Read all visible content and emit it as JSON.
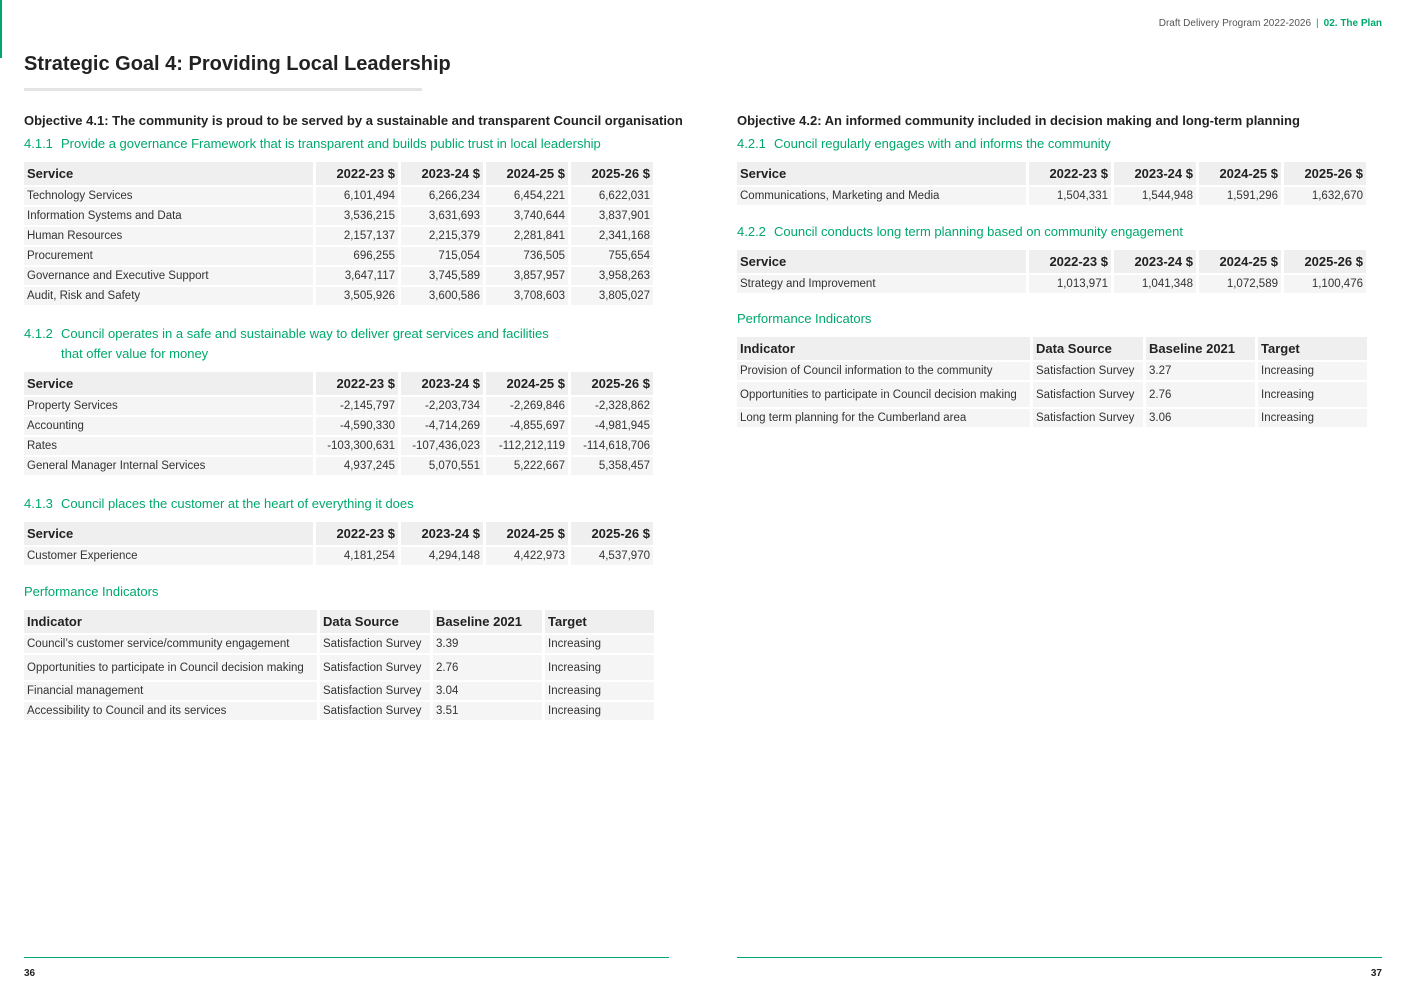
{
  "header": {
    "document_title": "Draft Delivery Program 2022-2026",
    "separator": "|",
    "section": "02. The Plan"
  },
  "left": {
    "goal_title": "Strategic Goal 4: Providing Local Leadership",
    "objective": "Objective 4.1: The community is proud to be served by a sustainable and transparent Council organisation",
    "sections": [
      {
        "number": "4.1.1",
        "title": "Provide a governance Framework that is transparent and builds public trust in local leadership",
        "columns": [
          "Service",
          "2022-23 $",
          "2023-24 $",
          "2024-25 $",
          "2025-26 $"
        ],
        "rows": [
          [
            "Technology Services",
            "6,101,494",
            "6,266,234",
            "6,454,221",
            "6,622,031"
          ],
          [
            "Information Systems and Data",
            "3,536,215",
            "3,631,693",
            "3,740,644",
            "3,837,901"
          ],
          [
            "Human Resources",
            "2,157,137",
            "2,215,379",
            "2,281,841",
            "2,341,168"
          ],
          [
            "Procurement",
            "696,255",
            "715,054",
            "736,505",
            "755,654"
          ],
          [
            "Governance and Executive Support",
            "3,647,117",
            "3,745,589",
            "3,857,957",
            "3,958,263"
          ],
          [
            "Audit, Risk and Safety",
            "3,505,926",
            "3,600,586",
            "3,708,603",
            "3,805,027"
          ]
        ]
      },
      {
        "number": "4.1.2",
        "title_line1": "Council operates in a safe and sustainable way to deliver great services and facilities",
        "title_line2": "that offer value for money",
        "columns": [
          "Service",
          "2022-23 $",
          "2023-24 $",
          "2024-25 $",
          "2025-26 $"
        ],
        "rows": [
          [
            "Property Services",
            "-2,145,797",
            "-2,203,734",
            "-2,269,846",
            "-2,328,862"
          ],
          [
            "Accounting",
            "-4,590,330",
            "-4,714,269",
            "-4,855,697",
            "-4,981,945"
          ],
          [
            "Rates",
            "-103,300,631",
            "-107,436,023",
            "-112,212,119",
            "-114,618,706"
          ],
          [
            "General Manager Internal Services",
            "4,937,245",
            "5,070,551",
            "5,222,667",
            "5,358,457"
          ]
        ]
      },
      {
        "number": "4.1.3",
        "title": "Council places the customer at the heart of everything it does",
        "columns": [
          "Service",
          "2022-23 $",
          "2023-24 $",
          "2024-25 $",
          "2025-26 $"
        ],
        "rows": [
          [
            "Customer Experience",
            "4,181,254",
            "4,294,148",
            "4,422,973",
            "4,537,970"
          ]
        ]
      }
    ],
    "performance": {
      "heading": "Performance Indicators",
      "columns": [
        "Indicator",
        "Data Source",
        "Baseline 2021",
        "Target"
      ],
      "rows": [
        [
          "Council’s customer service/community engagement",
          "Satisfaction Survey",
          "3.39",
          "Increasing"
        ],
        [
          "Opportunities to participate in Council decision making",
          "Satisfaction Survey",
          "2.76",
          "Increasing"
        ],
        [
          "Financial management",
          "Satisfaction Survey",
          "3.04",
          "Increasing"
        ],
        [
          "Accessibility to Council and its services",
          "Satisfaction Survey",
          "3.51",
          "Increasing"
        ]
      ]
    },
    "page_number": "36"
  },
  "right": {
    "objective": "Objective 4.2: An informed community included in decision making and long-term planning",
    "sections": [
      {
        "number": "4.2.1",
        "title": "Council regularly engages with and informs the community",
        "columns": [
          "Service",
          "2022-23 $",
          "2023-24 $",
          "2024-25 $",
          "2025-26 $"
        ],
        "rows": [
          [
            "Communications, Marketing and Media",
            "1,504,331",
            "1,544,948",
            "1,591,296",
            "1,632,670"
          ]
        ]
      },
      {
        "number": "4.2.2",
        "title": "Council conducts long term planning based on community engagement",
        "columns": [
          "Service",
          "2022-23 $",
          "2023-24 $",
          "2024-25 $",
          "2025-26 $"
        ],
        "rows": [
          [
            "Strategy and Improvement",
            "1,013,971",
            "1,041,348",
            "1,072,589",
            "1,100,476"
          ]
        ]
      }
    ],
    "performance": {
      "heading": "Performance Indicators",
      "columns": [
        "Indicator",
        "Data Source",
        "Baseline 2021",
        "Target"
      ],
      "rows": [
        [
          "Provision of Council information to the community",
          "Satisfaction Survey",
          "3.27",
          "Increasing"
        ],
        [
          "Opportunities to participate in Council decision making",
          "Satisfaction Survey",
          "2.76",
          "Increasing"
        ],
        [
          "Long term planning for the Cumberland area",
          "Satisfaction Survey",
          "3.06",
          "Increasing"
        ]
      ]
    },
    "page_number": "37"
  },
  "colors": {
    "accent": "#00a86b",
    "header_fill": "#efefef",
    "cell_fill": "#f5f5f5"
  }
}
